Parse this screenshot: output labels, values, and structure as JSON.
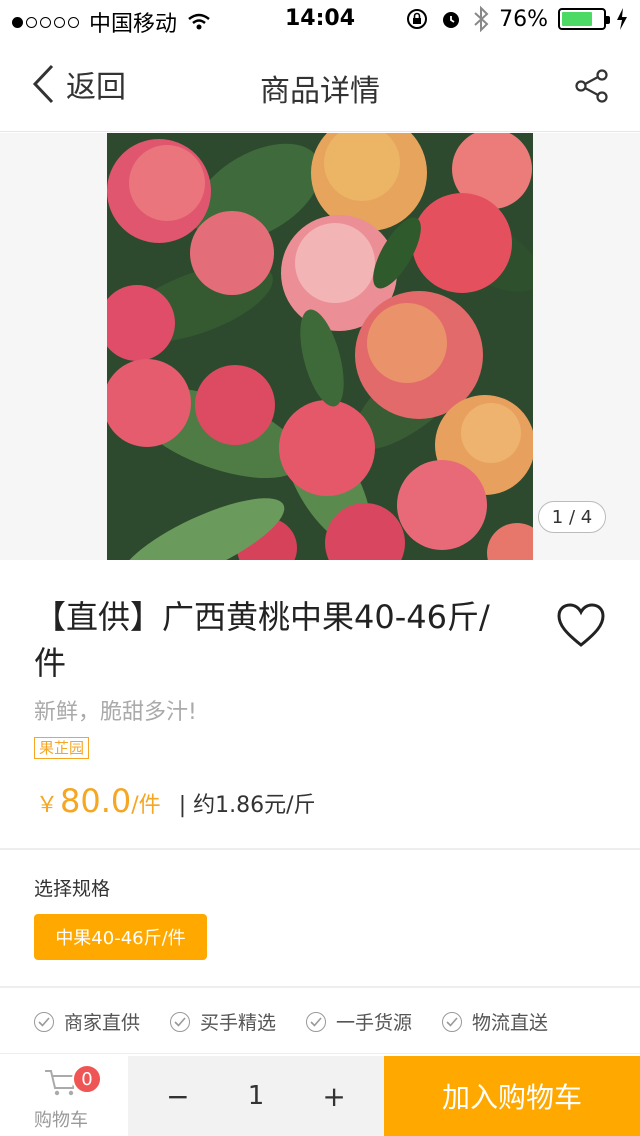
{
  "status_bar": {
    "carrier": "中国移动",
    "time": "14:04",
    "battery": "76%",
    "battery_level": 0.76,
    "signal_bars_on": 1
  },
  "nav": {
    "back_label": "返回",
    "title": "商品详情",
    "icons": {
      "back": "chevron-left-icon",
      "share": "share-icon"
    }
  },
  "gallery": {
    "image_desc": "product-photo",
    "pager": "1 / 4"
  },
  "product": {
    "title": "【直供】广西黄桃中果40-46斤/件",
    "subtitle": "新鲜，脆甜多汁!",
    "shop": "果芷园",
    "price_symbol": "￥",
    "price": "80.0",
    "price_unit": "/件",
    "unit_price": "| 约1.86元/斤",
    "colors": {
      "accent": "#ffa800",
      "price": "#f5a623"
    }
  },
  "spec": {
    "label": "选择规格",
    "option": "中果40-46斤/件"
  },
  "guarantees": [
    "商家直供",
    "买手精选",
    "一手货源",
    "物流直送"
  ],
  "bottom_bar": {
    "cart_label": "购物车",
    "cart_count": "0",
    "minus": "−",
    "quantity": "1",
    "plus": "+",
    "add_to_cart": "加入购物车"
  }
}
